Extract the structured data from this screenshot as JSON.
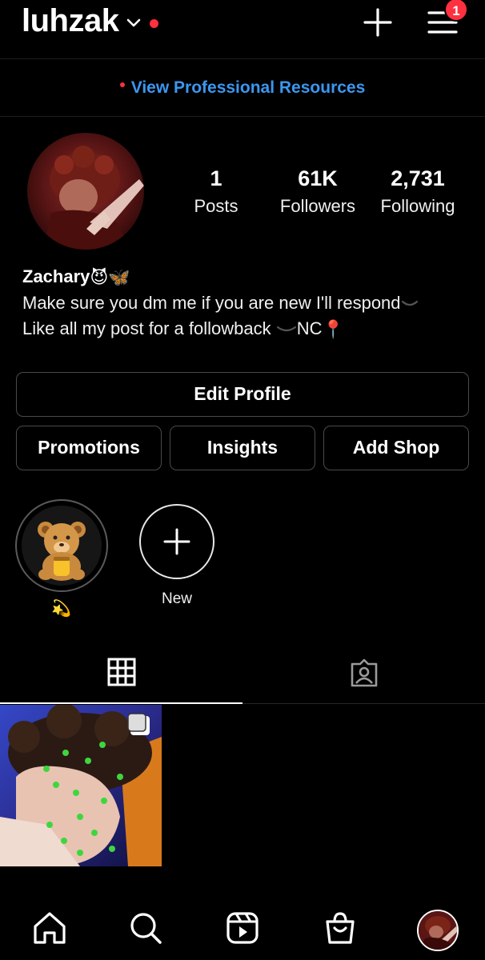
{
  "header": {
    "username": "luhzak",
    "notification_count": "1"
  },
  "pro_banner": {
    "label": "View Professional Resources"
  },
  "stats": [
    {
      "value": "1",
      "label": "Posts"
    },
    {
      "value": "61K",
      "label": "Followers"
    },
    {
      "value": "2,731",
      "label": "Following"
    }
  ],
  "bio": {
    "name": "Zachary",
    "name_emojis": [
      "😈",
      "🦋"
    ],
    "line1": "Make sure you dm me if you are new I'll respond",
    "line2_a": "Like all my post for a followback ",
    "line2_b": "NC",
    "line2_emoji": "📍"
  },
  "buttons": {
    "edit_profile": "Edit Profile",
    "promotions": "Promotions",
    "insights": "Insights",
    "add_shop": "Add Shop"
  },
  "highlights": [
    {
      "label": "💫",
      "icon": "teddy-bear"
    },
    {
      "label": "New",
      "icon": "plus-icon"
    }
  ],
  "tabs": [
    {
      "icon": "grid-icon",
      "active": true
    },
    {
      "icon": "tagged-icon",
      "active": false
    }
  ],
  "nav": [
    "home-icon",
    "search-icon",
    "reels-icon",
    "shop-icon",
    "profile-avatar"
  ],
  "colors": {
    "accent_blue": "#3b97f0",
    "badge_red": "#ff3040",
    "background": "#000000"
  }
}
